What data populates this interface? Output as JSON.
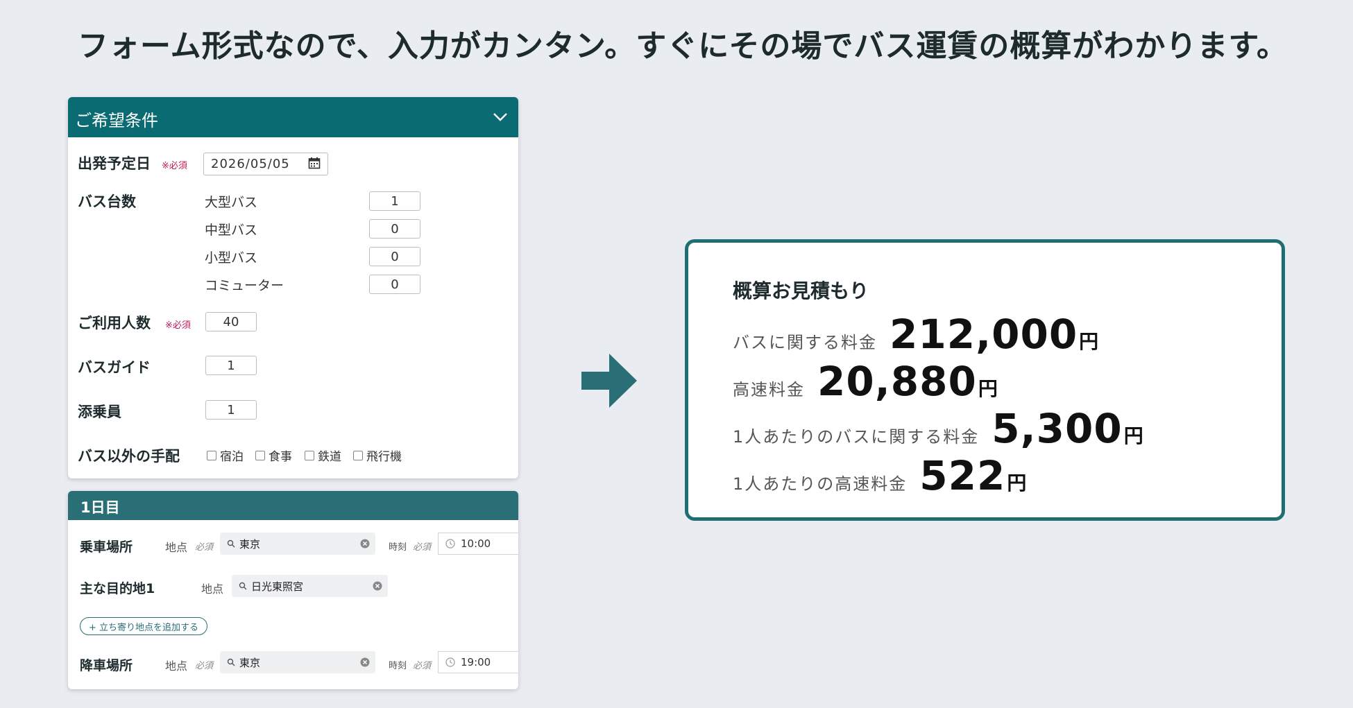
{
  "headline": "フォーム形式なので、入力がカンタン。すぐにその場でバス運賃の概算がわかります。",
  "conditions": {
    "title": "ご希望条件",
    "departure": {
      "label": "出発予定日",
      "required": "※必須",
      "value": "2026/05/05"
    },
    "bus_count": {
      "label": "バス台数",
      "types": [
        {
          "name": "大型バス",
          "value": "1"
        },
        {
          "name": "中型バス",
          "value": "0"
        },
        {
          "name": "小型バス",
          "value": "0"
        },
        {
          "name": "コミューター",
          "value": "0"
        }
      ]
    },
    "passengers": {
      "label": "ご利用人数",
      "required": "※必須",
      "value": "40"
    },
    "guide": {
      "label": "バスガイド",
      "value": "1"
    },
    "conductor": {
      "label": "添乗員",
      "value": "1"
    },
    "extras": {
      "label": "バス以外の手配",
      "options": [
        "宿泊",
        "食事",
        "鉄道",
        "飛行機"
      ]
    }
  },
  "day1": {
    "title": "1日目",
    "place_label": "地点",
    "time_label": "時刻",
    "required_small": "必須",
    "boarding": {
      "label": "乗車場所",
      "place": "東京",
      "time": "10:00"
    },
    "destination": {
      "label": "主な目的地1",
      "place": "日光東照宮"
    },
    "add_stop": "+ 立ち寄り地点を追加する",
    "alighting": {
      "label": "降車場所",
      "place": "東京",
      "time": "19:00"
    }
  },
  "estimate": {
    "title": "概算お見積もり",
    "unit": "円",
    "rows": [
      {
        "label": "バスに関する料金",
        "value": "212,000"
      },
      {
        "label": "高速料金",
        "value": "20,880"
      },
      {
        "label": "1人あたりのバスに関する料金",
        "value": "5,300"
      },
      {
        "label": "1人あたりの高速料金",
        "value": "522"
      }
    ]
  },
  "colors": {
    "accent": "#0b6b72",
    "accent_dark": "#2b6f76",
    "required": "#c2185b",
    "background": "#e9edf1"
  },
  "icons": [
    "chevron-down-icon",
    "calendar-icon",
    "search-icon",
    "clear-icon",
    "clock-icon",
    "arrow-right-icon"
  ]
}
